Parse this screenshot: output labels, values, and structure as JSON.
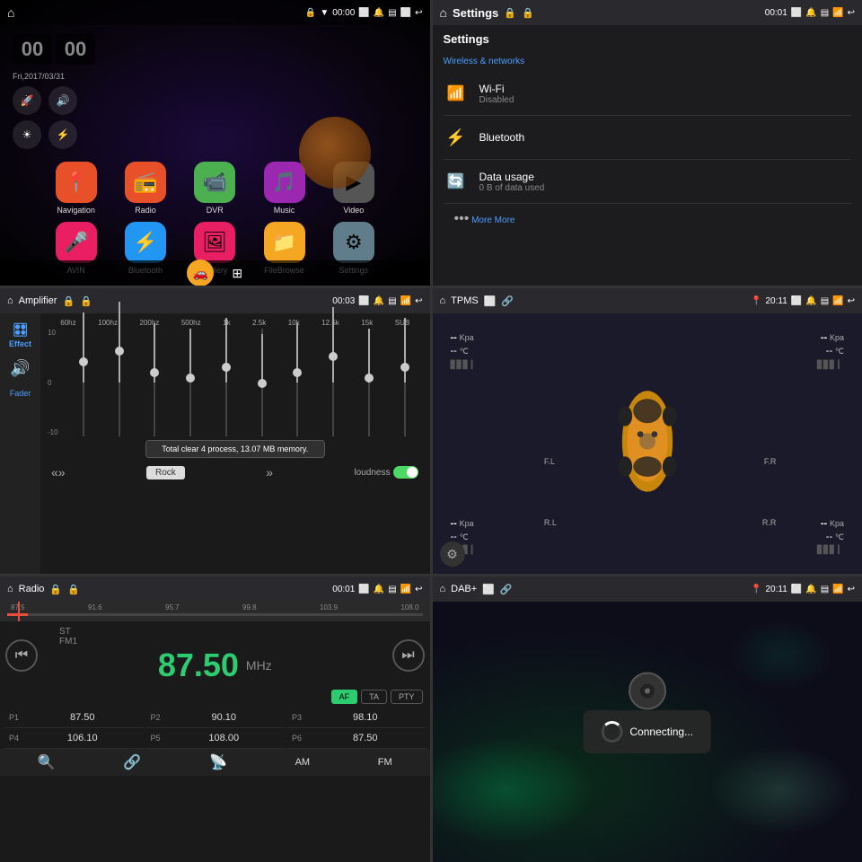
{
  "panels": {
    "home": {
      "time": "00:00",
      "date": "Fri,2017/03/31",
      "clock1": "00",
      "clock2": "00",
      "apps": [
        {
          "label": "Navigation",
          "bg": "#e8502a",
          "icon": "📍"
        },
        {
          "label": "Radio",
          "bg": "#e8502a",
          "icon": "📻"
        },
        {
          "label": "DVR",
          "bg": "#4caf50",
          "icon": "🎥"
        },
        {
          "label": "Music",
          "bg": "#9c27b0",
          "icon": "🎵"
        },
        {
          "label": "Video",
          "bg": "#555",
          "icon": "▶"
        },
        {
          "label": "AVIN",
          "bg": "#e91e63",
          "icon": "🎤"
        },
        {
          "label": "Bluetooth",
          "bg": "#2196f3",
          "icon": "⚡"
        },
        {
          "label": "Gallery",
          "bg": "#e91e63",
          "icon": "🖼"
        },
        {
          "label": "FileBrowse",
          "bg": "#f5a623",
          "icon": "📁"
        },
        {
          "label": "Settings",
          "bg": "#607d8b",
          "icon": "⚙"
        }
      ]
    },
    "settings": {
      "title": "Settings",
      "time": "00:01",
      "heading": "Settings",
      "section": "Wireless & networks",
      "items": [
        {
          "icon": "wifi",
          "name": "Wi-Fi",
          "sub": "Disabled"
        },
        {
          "icon": "bluetooth",
          "name": "Bluetooth",
          "sub": ""
        },
        {
          "icon": "data",
          "name": "Data usage",
          "sub": "0 B of data used"
        }
      ],
      "more": "More"
    },
    "eq": {
      "title": "Amplifier",
      "time": "00:03",
      "side_items": [
        "Effect",
        "Fader"
      ],
      "freq_labels": [
        "60hz",
        "100hz",
        "200hz",
        "500hz",
        "1k",
        "2.5k",
        "10k",
        "12.5k",
        "15k",
        "SUB"
      ],
      "db_labels": [
        "10",
        "0",
        "-10"
      ],
      "tooltip": "Total clear 4 process, 13.07 MB memory.",
      "slider_heights": [
        60,
        45,
        50,
        55,
        48,
        52,
        58,
        45,
        55,
        50
      ],
      "mode": "Rock",
      "loudness_label": "loudness",
      "prev": "«»",
      "next": "»"
    },
    "tpms": {
      "title": "TPMS",
      "time": "20:11",
      "corners": {
        "fl": {
          "kpa": "--",
          "tc": "--",
          "label": "F.L"
        },
        "fr": {
          "kpa": "--",
          "tc": "--",
          "label": "F.R"
        },
        "rl": {
          "kpa": "--",
          "tc": "--",
          "label": "R.L"
        },
        "rr": {
          "kpa": "--",
          "tc": "--",
          "label": "R.R"
        }
      }
    },
    "radio": {
      "title": "Radio",
      "time": "00:01",
      "freq_scale": [
        "87.5",
        "91.6",
        "95.7",
        "99.8",
        "103.9",
        "108.0"
      ],
      "st": "ST",
      "band": "FM1",
      "frequency": "87.50",
      "unit": "MHz",
      "buttons": [
        "AF",
        "TA",
        "PTY"
      ],
      "active_btn": "AF",
      "presets": [
        {
          "num": "P1",
          "freq": "87.50"
        },
        {
          "num": "P2",
          "freq": "90.10"
        },
        {
          "num": "P3",
          "freq": "98.10"
        },
        {
          "num": "P4",
          "freq": "106.10"
        },
        {
          "num": "P5",
          "freq": "108.00"
        },
        {
          "num": "P6",
          "freq": "87.50"
        }
      ],
      "am_label": "AM",
      "fm_label": "FM"
    },
    "dab": {
      "title": "DAB+",
      "time": "20:11",
      "connecting_text": "Connecting..."
    }
  },
  "icons": {
    "home": "⌂",
    "back": "↩",
    "wifi": "📶",
    "bluetooth": "⚡",
    "data": "🔄",
    "settings": "⚙",
    "search": "🔍",
    "link": "🔗",
    "antenna": "📡",
    "speaker": "🔊"
  }
}
